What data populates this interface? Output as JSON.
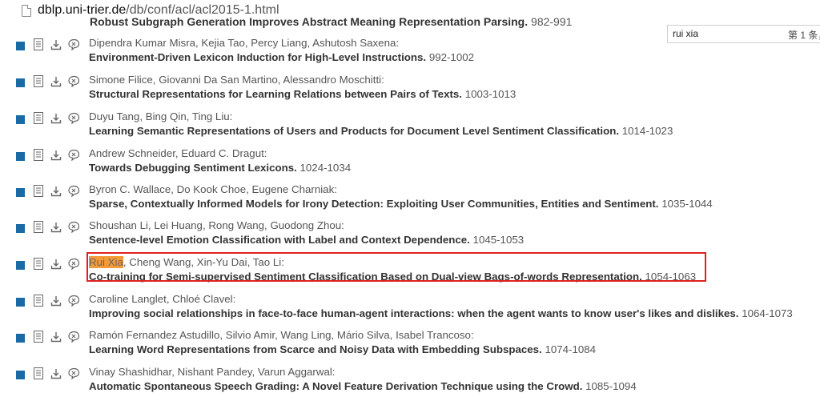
{
  "browser": {
    "url_host": "dblp.uni-trier.de",
    "url_path": "/db/conf/acl/acl2015-1.html"
  },
  "find_bar": {
    "query": "rui xia",
    "result_label": "第 1 条，"
  },
  "clipped_entry": {
    "title": "Robust Subgraph Generation Improves Abstract Meaning Representation Parsing.",
    "pages": "982-991"
  },
  "entries": [
    {
      "authors": "Dipendra Kumar Misra, Kejia Tao, Percy Liang, Ashutosh Saxena:",
      "title": "Environment-Driven Lexicon Induction for High-Level Instructions.",
      "pages": "992-1002"
    },
    {
      "authors": "Simone Filice, Giovanni Da San Martino, Alessandro Moschitti:",
      "title": "Structural Representations for Learning Relations between Pairs of Texts.",
      "pages": "1003-1013"
    },
    {
      "authors": "Duyu Tang, Bing Qin, Ting Liu:",
      "title": "Learning Semantic Representations of Users and Products for Document Level Sentiment Classification.",
      "pages": "1014-1023"
    },
    {
      "authors": "Andrew Schneider, Eduard C. Dragut:",
      "title": "Towards Debugging Sentiment Lexicons.",
      "pages": "1024-1034"
    },
    {
      "authors": "Byron C. Wallace, Do Kook Choe, Eugene Charniak:",
      "title": "Sparse, Contextually Informed Models for Irony Detection: Exploiting User Communities, Entities and Sentiment.",
      "pages": "1035-1044"
    },
    {
      "authors": "Shoushan Li, Lei Huang, Rong Wang, Guodong Zhou:",
      "title": "Sentence-level Emotion Classification with Label and Context Dependence.",
      "pages": "1045-1053"
    },
    {
      "authors_highlight": "Rui Xia",
      "authors": ", Cheng Wang, Xin-Yu Dai, Tao Li:",
      "title": "Co-training for Semi-supervised Sentiment Classification Based on Dual-view Bags-of-words Representation.",
      "pages": "1054-1063"
    },
    {
      "authors": "Caroline Langlet, Chloé Clavel:",
      "title": "Improving social relationships in face-to-face human-agent interactions: when the agent wants to know user's likes and dislikes.",
      "pages": "1064-1073"
    },
    {
      "authors": "Ramón Fernandez Astudillo, Silvio Amir, Wang Ling, Mário Silva, Isabel Trancoso:",
      "title": "Learning Word Representations from Scarce and Noisy Data with Embedding Subspaces.",
      "pages": "1074-1084"
    },
    {
      "authors": "Vinay Shashidhar, Nishant Pandey, Varun Aggarwal:",
      "title": "Automatic Spontaneous Speech Grading: A Novel Feature Derivation Technique using the Crowd.",
      "pages": "1085-1094"
    }
  ],
  "colors": {
    "bullet": "#1a6aa6",
    "find_highlight": "#f49a37",
    "annotation_box": "#e02020"
  },
  "icons": [
    "document-icon",
    "download-icon",
    "share-icon"
  ]
}
